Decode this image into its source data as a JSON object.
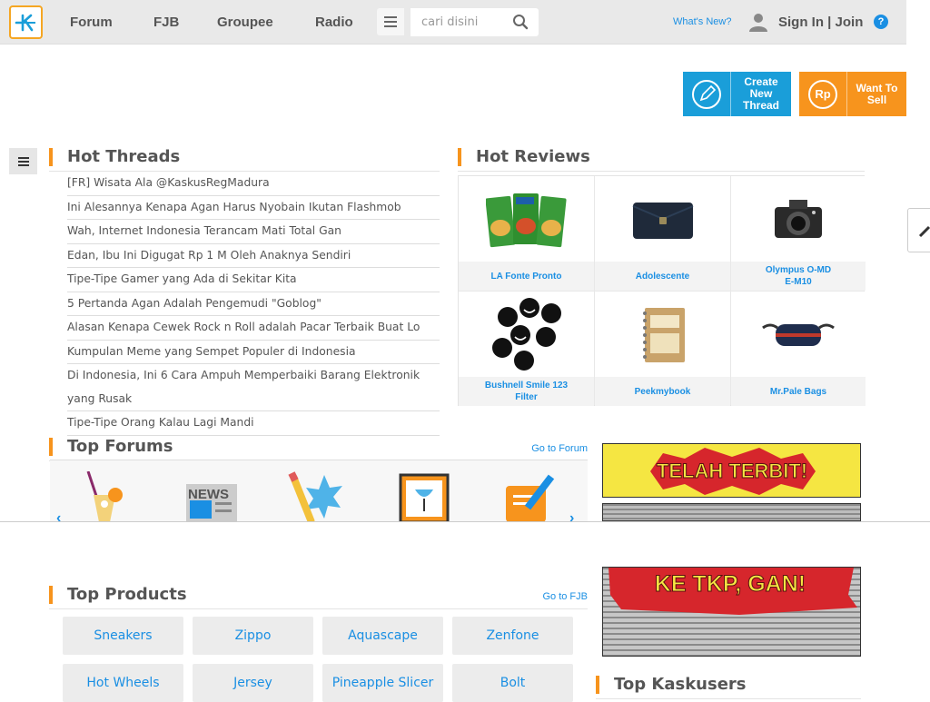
{
  "nav": {
    "logo": "K",
    "links": [
      "Forum",
      "FJB",
      "Groupee",
      "Radio"
    ],
    "search_placeholder": "cari disini",
    "whats_new": "What's New?",
    "signin": "Sign In | Join",
    "help": "?"
  },
  "actions": {
    "create_thread": "Create\nNew\nThread",
    "want_to_sell": "Want To\nSell",
    "sell_icon_text": "Rp"
  },
  "hot_threads": {
    "title": "Hot Threads",
    "items": [
      "[FR] Wisata Ala @KaskusRegMadura",
      "Ini Alesannya Kenapa Agan Harus Nyobain Ikutan Flashmob",
      "Wah, Internet Indonesia Terancam Mati Total Gan",
      "Edan, Ibu Ini Digugat Rp 1 M Oleh Anaknya Sendiri",
      "Tipe-Tipe Gamer yang Ada di Sekitar Kita",
      "5 Pertanda Agan Adalah Pengemudi \"Goblog\"",
      "Alasan Kenapa Cewek Rock n Roll adalah Pacar Terbaik Buat Lo",
      "Kumpulan Meme yang Sempet Populer di Indonesia",
      "Di Indonesia, Ini 6 Cara Ampuh Memperbaiki Barang Elektronik yang Rusak",
      "Tipe-Tipe Orang Kalau Lagi Mandi"
    ]
  },
  "hot_reviews": {
    "title": "Hot Reviews",
    "items": [
      {
        "name": "LA Fonte Pronto",
        "icon": "noodle-pack-icon"
      },
      {
        "name": "Adolescente",
        "icon": "wallet-icon"
      },
      {
        "name": "Olympus O-MD\nE-M10",
        "icon": "camera-icon"
      },
      {
        "name": "Bushnell Smile 123\nFilter",
        "icon": "smile-filter-icon"
      },
      {
        "name": "Peekmybook",
        "icon": "notebook-icon"
      },
      {
        "name": "Mr.Pale Bags",
        "icon": "waist-bag-icon"
      }
    ]
  },
  "top_forums": {
    "title": "Top Forums",
    "go": "Go to Forum",
    "news_label": "NEWS"
  },
  "banners": {
    "first": "TELAH TERBIT!",
    "second": "KE TKP, GAN!"
  },
  "top_products": {
    "title": "Top Products",
    "go": "Go to FJB",
    "items": [
      "Sneakers",
      "Zippo",
      "Aquascape",
      "Zenfone",
      "Hot Wheels",
      "Jersey",
      "Pineapple Slicer",
      "Bolt"
    ]
  },
  "top_kaskusers": {
    "title": "Top Kaskusers"
  },
  "colors": {
    "accent_orange": "#f7941d",
    "link_blue": "#1a8fe3"
  }
}
